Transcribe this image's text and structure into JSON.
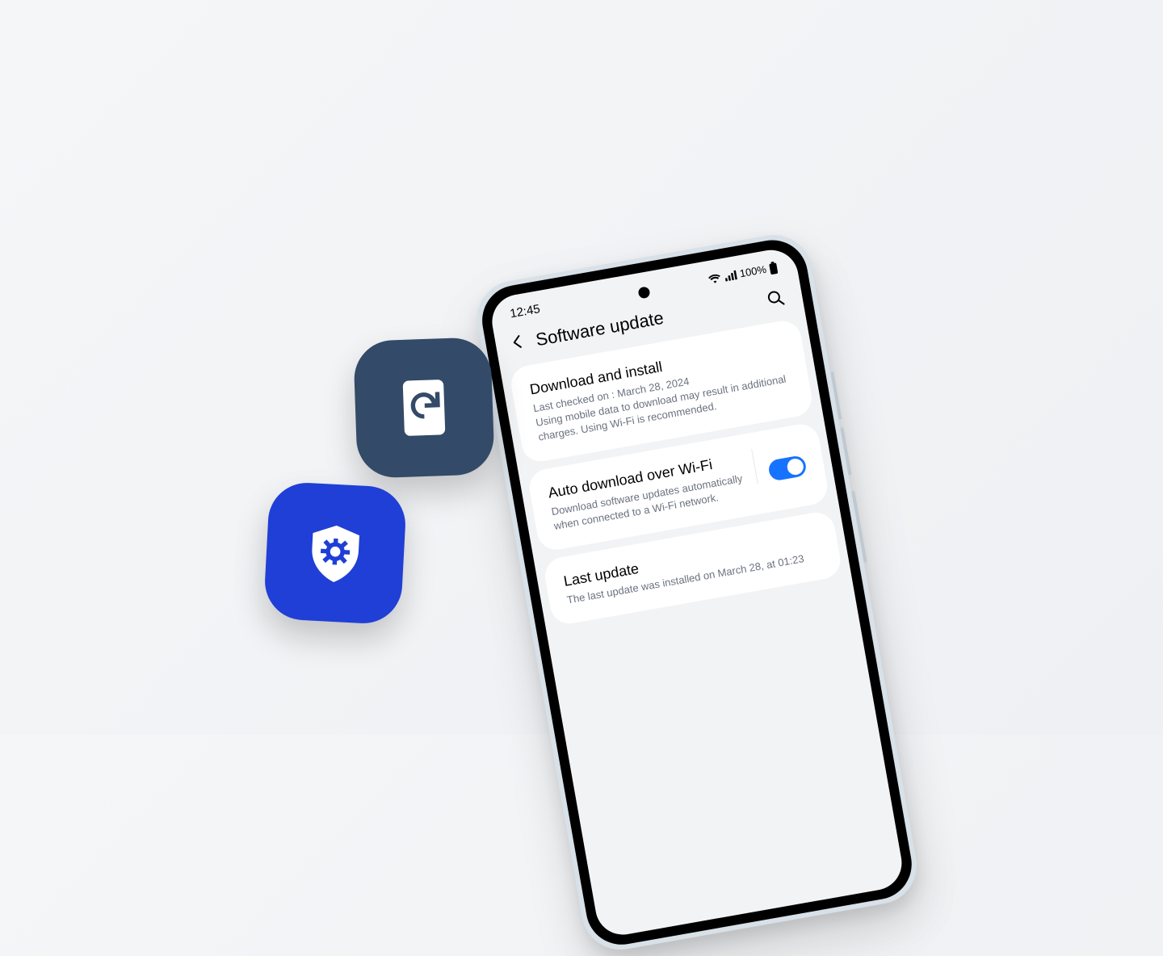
{
  "status_bar": {
    "time": "12:45",
    "battery_text": "100%"
  },
  "header": {
    "title": "Software update"
  },
  "cards": {
    "download": {
      "title": "Download and install",
      "line1": "Last checked on : March 28, 2024",
      "line2": "Using mobile data to download may result in additional charges. Using Wi-Fi is recommended."
    },
    "auto_wifi": {
      "title": "Auto download over Wi-Fi",
      "sub": "Download software updates automatically when connected to a Wi-Fi network."
    },
    "last_update": {
      "title": "Last update",
      "sub": "The last update was installed on March 28, at 01:23"
    }
  }
}
